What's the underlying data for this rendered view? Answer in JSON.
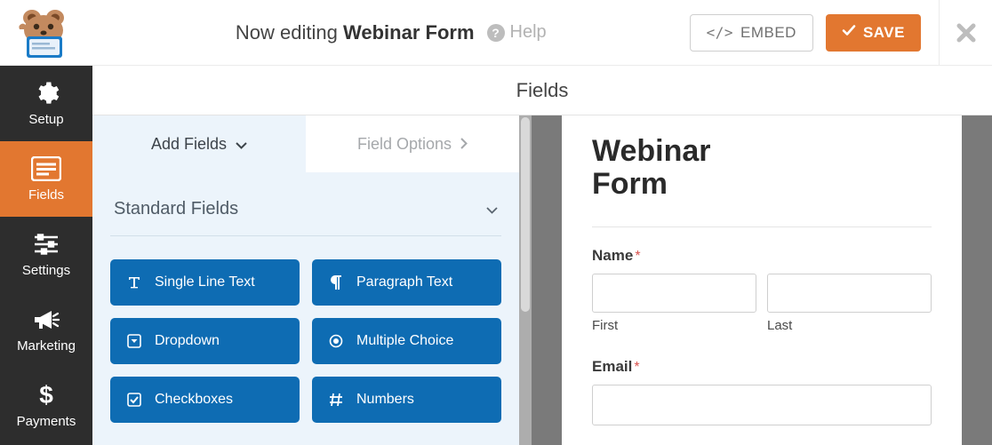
{
  "header": {
    "editing_prefix": "Now editing",
    "form_name": "Webinar Form",
    "help_label": "Help",
    "embed_label": "EMBED",
    "save_label": "SAVE"
  },
  "sidebar": {
    "items": [
      {
        "label": "Setup",
        "icon": "gear-icon",
        "active": false
      },
      {
        "label": "Fields",
        "icon": "form-icon",
        "active": true
      },
      {
        "label": "Settings",
        "icon": "sliders-icon",
        "active": false
      },
      {
        "label": "Marketing",
        "icon": "bullhorn-icon",
        "active": false
      },
      {
        "label": "Payments",
        "icon": "dollar-icon",
        "active": false
      }
    ]
  },
  "main_header": "Fields",
  "tabs": {
    "add": "Add Fields",
    "options": "Field Options"
  },
  "group_title": "Standard Fields",
  "fields": [
    {
      "label": "Single Line Text",
      "icon": "text-icon"
    },
    {
      "label": "Paragraph Text",
      "icon": "paragraph-icon"
    },
    {
      "label": "Dropdown",
      "icon": "caret-square-icon"
    },
    {
      "label": "Multiple Choice",
      "icon": "radio-icon"
    },
    {
      "label": "Checkboxes",
      "icon": "checkbox-icon"
    },
    {
      "label": "Numbers",
      "icon": "hash-icon"
    }
  ],
  "preview": {
    "title": "Webinar Form",
    "name_label": "Name",
    "first_label": "First",
    "last_label": "Last",
    "email_label": "Email"
  },
  "colors": {
    "accent": "#e27730",
    "primary_blue": "#0e6cb3",
    "panel_bg": "#ecf4fb",
    "sidebar_bg": "#2d2d2d"
  }
}
